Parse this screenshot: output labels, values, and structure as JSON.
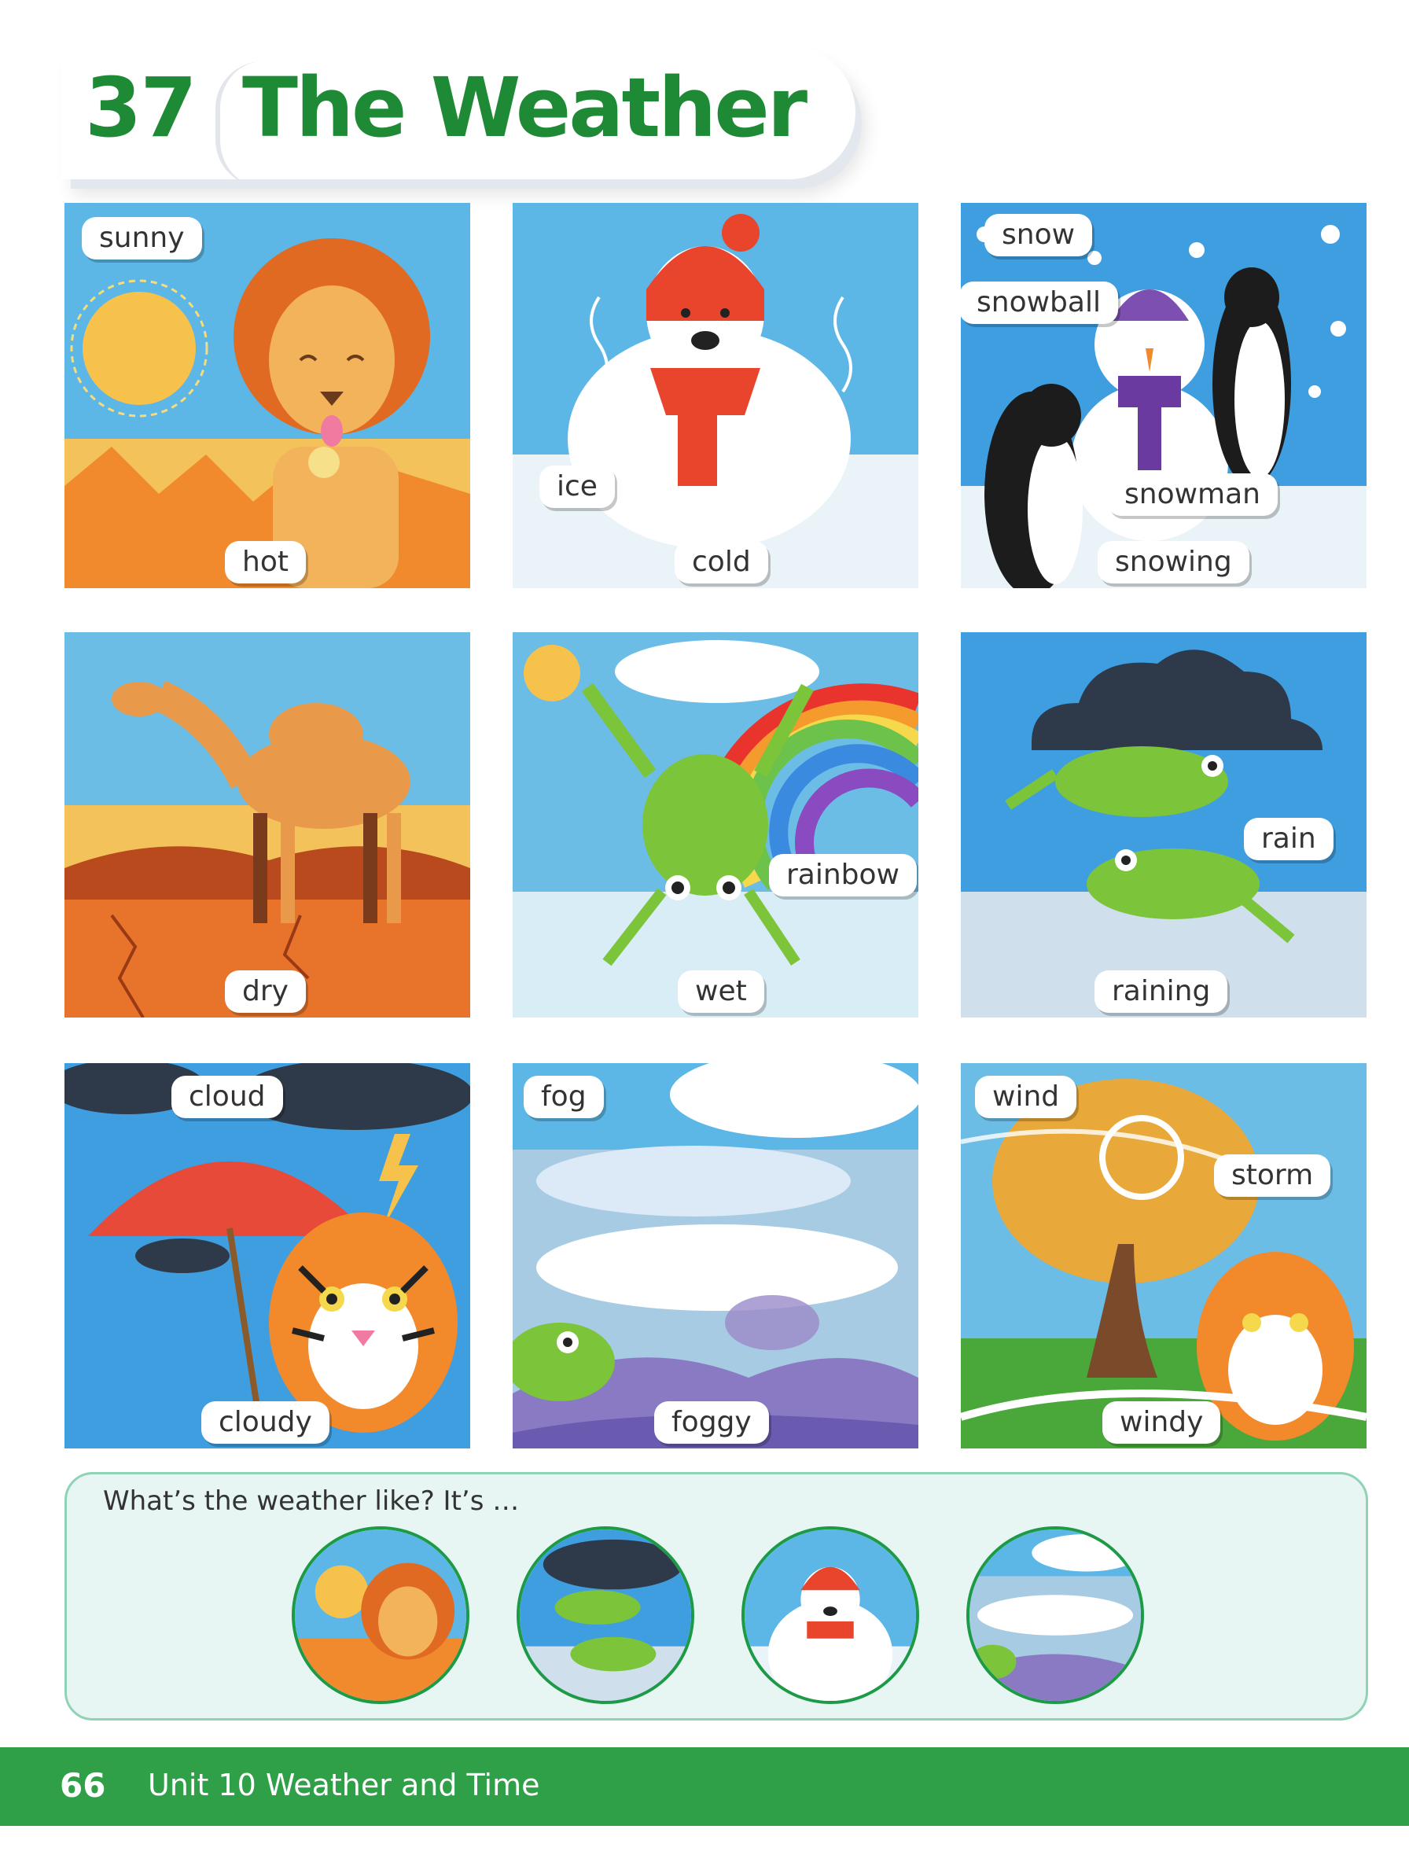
{
  "header": {
    "number": "37",
    "title": "The Weather"
  },
  "panels": [
    {
      "labels": [
        "sunny",
        "hot"
      ]
    },
    {
      "labels": [
        "ice",
        "cold"
      ]
    },
    {
      "labels": [
        "snow",
        "snowball",
        "snowman",
        "snowing"
      ]
    },
    {
      "labels": [
        "dry"
      ]
    },
    {
      "labels": [
        "rainbow",
        "wet"
      ]
    },
    {
      "labels": [
        "rain",
        "raining"
      ]
    },
    {
      "labels": [
        "cloud",
        "cloudy"
      ]
    },
    {
      "labels": [
        "fog",
        "foggy"
      ]
    },
    {
      "labels": [
        "wind",
        "storm",
        "windy"
      ]
    }
  ],
  "quiz": {
    "question": "What’s the weather like? It’s …"
  },
  "footer": {
    "page": "66",
    "unit": "Unit 10  Weather and Time"
  }
}
